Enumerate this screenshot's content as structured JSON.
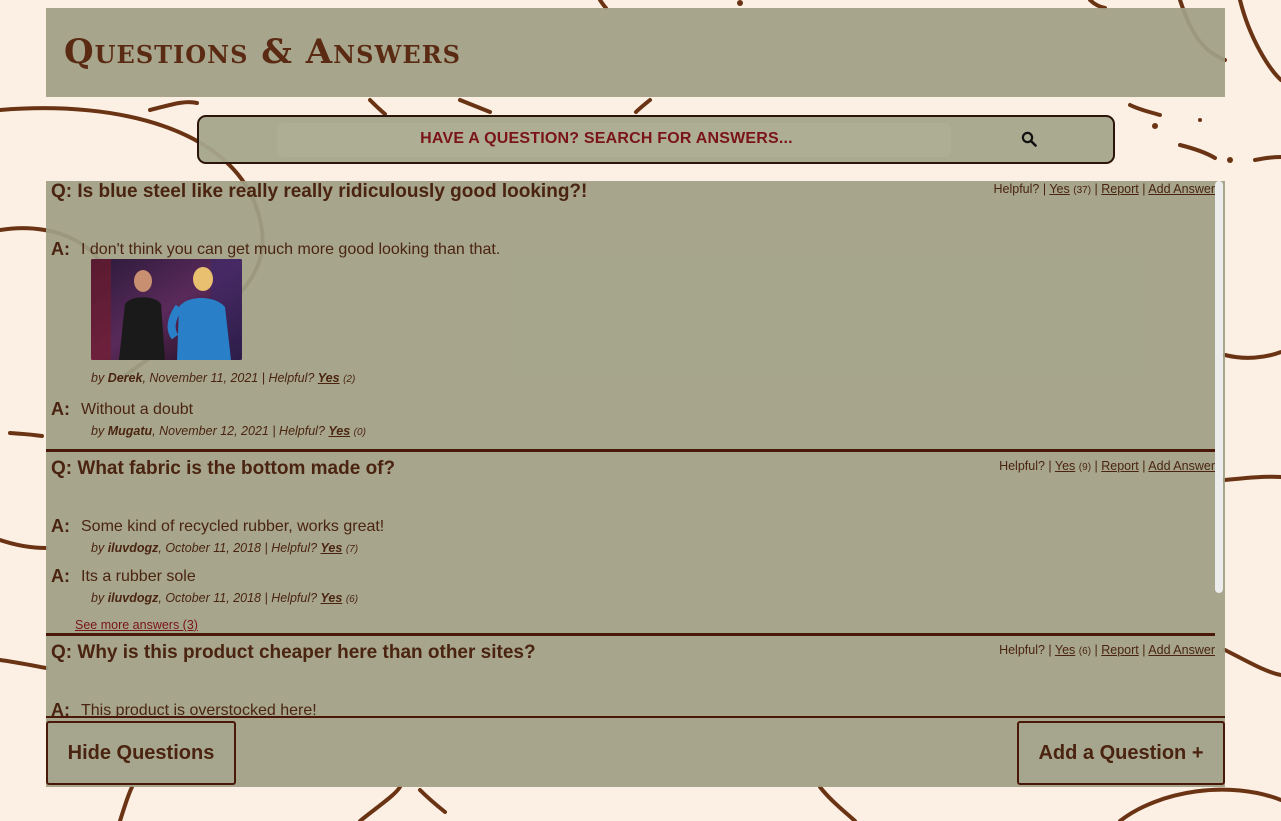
{
  "header": {
    "title": "Questions & Answers"
  },
  "search": {
    "placeholder": "HAVE A QUESTION? SEARCH FOR ANSWERS...",
    "icon": "search-icon"
  },
  "questions": [
    {
      "text": "Q: Is blue steel like really really ridiculously good looking?!",
      "helpful_label": "Helpful? |",
      "yes_label": "Yes",
      "yes_count": "(37)",
      "report_label": "Report",
      "add_answer_label": "Add Answer",
      "answers": [
        {
          "label": "A:",
          "body": "I don't think you can get much more good looking than that.",
          "by": "by",
          "author": "Derek",
          "date": ", November 11, 2021 | Helpful?",
          "yes": "Yes",
          "count": "(2)",
          "has_photo": true
        },
        {
          "label": "A:",
          "body": "Without a doubt",
          "by": "by",
          "author": "Mugatu",
          "date": ", November 12, 2021 | Helpful?",
          "yes": "Yes",
          "count": "(0)"
        }
      ]
    },
    {
      "text": "Q: What fabric is the bottom made of?",
      "helpful_label": "Helpful? |",
      "yes_label": "Yes",
      "yes_count": "(9)",
      "report_label": "Report",
      "add_answer_label": "Add Answer",
      "answers": [
        {
          "label": "A:",
          "body": "Some kind of recycled rubber, works great!",
          "by": "by",
          "author": "iluvdogz",
          "date": ", October 11, 2018 | Helpful?",
          "yes": "Yes",
          "count": "(7)"
        },
        {
          "label": "A:",
          "body": "Its a rubber sole",
          "by": "by",
          "author": "iluvdogz",
          "date": ", October 11, 2018 | Helpful?",
          "yes": "Yes",
          "count": "(6)"
        }
      ],
      "see_more": "See more answers (3)"
    },
    {
      "text": "Q: Why is this product cheaper here than other sites?",
      "helpful_label": "Helpful? |",
      "yes_label": "Yes",
      "yes_count": "(6)",
      "report_label": "Report",
      "add_answer_label": "Add Answer",
      "answers": [
        {
          "label": "A:",
          "body": "This product is overstocked here!"
        }
      ]
    }
  ],
  "footer": {
    "hide_label": "Hide Questions",
    "add_label": "Add a Question +"
  },
  "colors": {
    "background": "#fcefe3",
    "panel": "#a0a086",
    "text": "#4a2410",
    "accent": "#7a1418",
    "divider": "#4a1808"
  }
}
